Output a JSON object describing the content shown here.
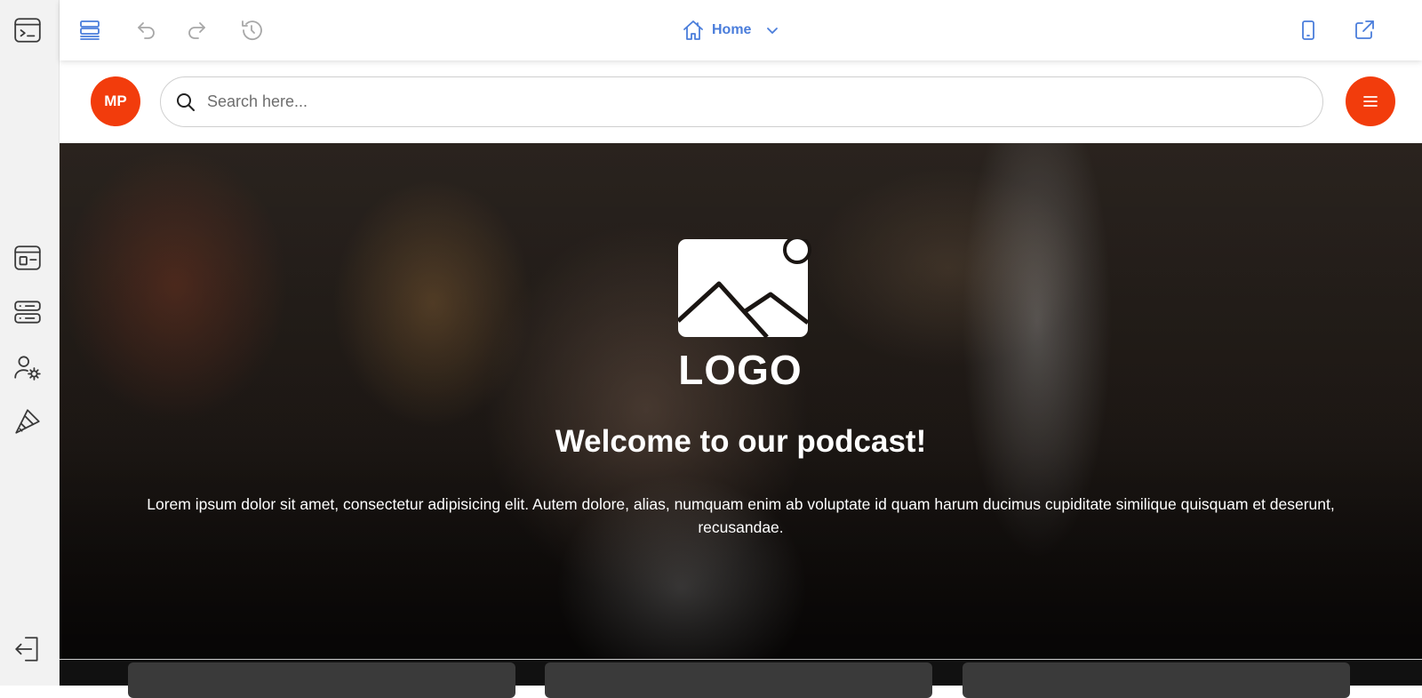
{
  "toolbar": {
    "page_selector_label": "Home"
  },
  "header": {
    "avatar_initials": "MP",
    "search_placeholder": "Search here..."
  },
  "hero": {
    "logo_text": "LOGO",
    "title": "Welcome to our podcast!",
    "description": "Lorem ipsum dolor sit amet, consectetur adipisicing elit. Autem dolore, alias, numquam enim ab voluptate id quam harum ducimus cupiditate similique quisquam et deserunt, recusandae."
  },
  "colors": {
    "accent": "#f23c0c",
    "toolbar_blue": "#4a7ddb"
  }
}
